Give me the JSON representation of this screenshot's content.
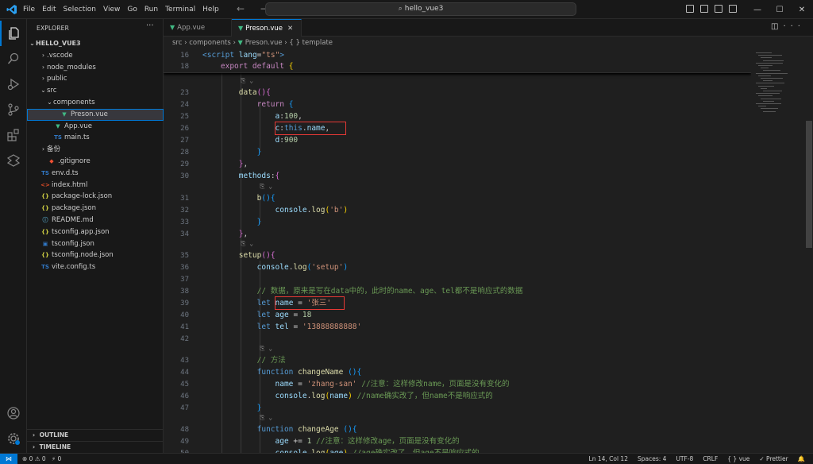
{
  "menu": [
    "File",
    "Edit",
    "Selection",
    "View",
    "Go",
    "Run",
    "Terminal",
    "Help"
  ],
  "search": {
    "text": "hello_vue3"
  },
  "nav_arrows": "← →",
  "window_controls": [
    "—",
    "☐",
    "✕"
  ],
  "explorer": {
    "title": "EXPLORER",
    "more": "···",
    "root": "HELLO_VUE3",
    "items": [
      {
        "label": ".vscode",
        "chev": "›",
        "indent": 1,
        "icon": ""
      },
      {
        "label": "node_modules",
        "chev": "›",
        "indent": 1,
        "icon": ""
      },
      {
        "label": "public",
        "chev": "›",
        "indent": 1,
        "icon": ""
      },
      {
        "label": "src",
        "chev": "⌄",
        "indent": 1,
        "icon": ""
      },
      {
        "label": "components",
        "chev": "⌄",
        "indent": 2,
        "icon": ""
      },
      {
        "label": "Preson.vue",
        "chev": "",
        "indent": 3,
        "icon": "▼",
        "icon_color": "#41b883",
        "selected": true
      },
      {
        "label": "App.vue",
        "chev": "",
        "indent": 2,
        "icon": "▼",
        "icon_color": "#41b883"
      },
      {
        "label": "main.ts",
        "chev": "",
        "indent": 2,
        "icon": "TS",
        "icon_color": "#3178c6"
      },
      {
        "label": "备份",
        "chev": "›",
        "indent": 1,
        "icon": ""
      },
      {
        "label": ".gitignore",
        "chev": "",
        "indent": 1,
        "icon": "◆",
        "icon_color": "#f05033"
      },
      {
        "label": "env.d.ts",
        "chev": "",
        "indent": 0,
        "icon": "TS",
        "icon_color": "#3178c6"
      },
      {
        "label": "index.html",
        "chev": "",
        "indent": 0,
        "icon": "<>",
        "icon_color": "#e44d26"
      },
      {
        "label": "package-lock.json",
        "chev": "",
        "indent": 0,
        "icon": "{}",
        "icon_color": "#cbcb41"
      },
      {
        "label": "package.json",
        "chev": "",
        "indent": 0,
        "icon": "{}",
        "icon_color": "#cbcb41"
      },
      {
        "label": "README.md",
        "chev": "",
        "indent": 0,
        "icon": "ⓘ",
        "icon_color": "#519aba"
      },
      {
        "label": "tsconfig.app.json",
        "chev": "",
        "indent": 0,
        "icon": "{}",
        "icon_color": "#cbcb41"
      },
      {
        "label": "tsconfig.json",
        "chev": "",
        "indent": 0,
        "icon": "▣",
        "icon_color": "#3178c6"
      },
      {
        "label": "tsconfig.node.json",
        "chev": "",
        "indent": 0,
        "icon": "{}",
        "icon_color": "#cbcb41"
      },
      {
        "label": "vite.config.ts",
        "chev": "",
        "indent": 0,
        "icon": "TS",
        "icon_color": "#3178c6"
      }
    ],
    "outline": "OUTLINE",
    "timeline": "TIMELINE"
  },
  "tabs": [
    {
      "label": "App.vue",
      "active": false
    },
    {
      "label": "Preson.vue",
      "active": true
    }
  ],
  "tab_close": "✕",
  "breadcrumb": [
    "src",
    "components",
    "Preson.vue",
    "{ } template"
  ],
  "hint_text": "⎘ ⌄",
  "status": {
    "remote": "⋈",
    "problems": "⊗ 0 ⚠ 0",
    "ports": "⚡ 0",
    "position": "Ln 14, Col 12",
    "spaces": "Spaces: 4",
    "encoding": "UTF-8",
    "eol": "CRLF",
    "language": "{ } vue",
    "prettier": "✓ Prettier",
    "bell": "🔔"
  }
}
